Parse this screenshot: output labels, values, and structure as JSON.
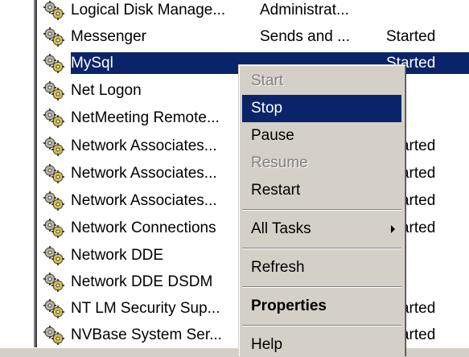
{
  "services": [
    {
      "name": "Logical Disk Manage...",
      "description": "Administrat...",
      "status": "",
      "selected": false
    },
    {
      "name": "Messenger",
      "description": "Sends and ...",
      "status": "Started",
      "selected": false
    },
    {
      "name": "MySql",
      "description": "",
      "status": "Started",
      "selected": true
    },
    {
      "name": "Net Logon",
      "description": "",
      "status": "",
      "selected": false
    },
    {
      "name": "NetMeeting Remote...",
      "description": "",
      "status": "",
      "selected": false
    },
    {
      "name": "Network Associates...",
      "description": "",
      "status": "Started",
      "selected": false
    },
    {
      "name": "Network Associates...",
      "description": "",
      "status": "Started",
      "selected": false
    },
    {
      "name": "Network Associates...",
      "description": "",
      "status": "Started",
      "selected": false
    },
    {
      "name": "Network Connections",
      "description": "",
      "status": "Started",
      "selected": false
    },
    {
      "name": "Network DDE",
      "description": "",
      "status": "",
      "selected": false
    },
    {
      "name": "Network DDE DSDM",
      "description": "",
      "status": "",
      "selected": false
    },
    {
      "name": "NT LM Security Sup...",
      "description": "",
      "status": "Started",
      "selected": false
    },
    {
      "name": "NVBase System Ser...",
      "description": "",
      "status": "Started",
      "selected": false
    }
  ],
  "context_menu": {
    "items": [
      {
        "label": "Start",
        "disabled": true
      },
      {
        "label": "Stop",
        "highlighted": true
      },
      {
        "label": "Pause"
      },
      {
        "label": "Resume",
        "disabled": true
      },
      {
        "label": "Restart"
      },
      {
        "separator": true
      },
      {
        "label": "All Tasks",
        "submenu": true
      },
      {
        "separator": true
      },
      {
        "label": "Refresh"
      },
      {
        "separator": true
      },
      {
        "label": "Properties",
        "bold": true
      },
      {
        "separator": true
      },
      {
        "label": "Help"
      }
    ]
  },
  "colors": {
    "selection": "#0a246a",
    "menu_background": "#d4d0c8",
    "disabled_text": "#808080"
  },
  "icon": "service-gears-icon"
}
